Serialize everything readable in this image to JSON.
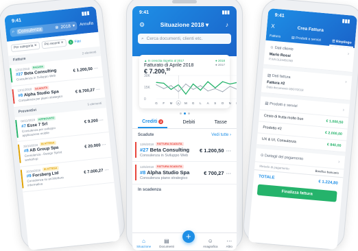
{
  "status_time": "9:41",
  "phone1": {
    "search_value": "Consulenza",
    "year": "2018",
    "cancel_label": "Annulla",
    "chips": [
      "Per categoria",
      "Più recenti"
    ],
    "filters_label": "Filtri",
    "filters_count": "1",
    "sections": [
      {
        "title": "Fatture",
        "count": "2 elementi",
        "rows": [
          {
            "date": "12/11/2018",
            "badge": "PAGATA",
            "badge_color": "#25b36b",
            "badge_bg": "#dff5e9",
            "number": "#27",
            "name": "Beta Consulting",
            "desc": "Consulenza in Sviluppo Web",
            "amount": "€ 1.200,50"
          },
          {
            "date": "12/11/2018",
            "badge": "SCADUTA",
            "badge_color": "#e8453c",
            "badge_bg": "#fde3e1",
            "number": "#8",
            "name": "Alpha Studio Spa",
            "desc": "Consulenza per piano strategico",
            "amount": "€ 8.700,27"
          }
        ]
      },
      {
        "title": "Preventivi",
        "count": "5 elementi",
        "rows": [
          {
            "date": "02/11/2018",
            "badge": "APPROVATO",
            "badge_color": "#25b36b",
            "badge_bg": "#dff5e9",
            "number": "#7",
            "name": "Esse 7 Srl",
            "desc": "Consulenza per sviluppo applicazione mobile",
            "amount": "€ 9.200"
          },
          {
            "date": "28/10/2018",
            "badge": "IN ATTESA",
            "badge_color": "#e0a100",
            "badge_bg": "#fdf1cc",
            "number": "#8",
            "name": "AB Group Spa",
            "desc": "Consulenza - Design Sprint workshop",
            "amount": "€ 20.000"
          },
          {
            "date": "16/10/2018",
            "badge": "IN ATTESA",
            "badge_color": "#e0a100",
            "badge_bg": "#fdf1cc",
            "number": "#9",
            "name": "Forsberg Ltd",
            "desc": "Consulenza su architettura informativa",
            "amount": "€ 7.000,27"
          }
        ]
      }
    ]
  },
  "phone2": {
    "title": "Situazione 2018",
    "search_placeholder": "Cerca documenti, clienti etc.",
    "chart_trend": "In crescita rispetto al 2017",
    "chart_label": "Fatturato di Aprile 2018",
    "chart_total": "€ 7.200,",
    "chart_total_cents": "50",
    "chart_data": {
      "type": "line",
      "categories": [
        "G",
        "F",
        "M",
        "A",
        "M",
        "G",
        "L",
        "A",
        "S",
        "O",
        "N",
        "D"
      ],
      "y_ticks": [
        "30K",
        "15K",
        "0"
      ],
      "ylim": [
        0,
        30000
      ],
      "series": [
        {
          "name": "2018",
          "color": "#25b36b",
          "values": [
            21000,
            20000,
            12000,
            18000,
            6000,
            19000,
            11000,
            22000,
            14000,
            22000,
            19000,
            21000
          ]
        },
        {
          "name": "2017",
          "color": "#9aa4b1",
          "values": [
            18000,
            13000,
            17000,
            9000,
            19000,
            12000,
            17000,
            10000,
            13000,
            9000,
            16000,
            12000
          ]
        }
      ]
    },
    "tabs": [
      {
        "label": "Crediti",
        "badge": "2"
      },
      {
        "label": "Debiti",
        "badge": ""
      },
      {
        "label": "Tasse",
        "badge": ""
      }
    ],
    "scadute_label": "Scadute",
    "view_all_label": "Vedi tutte",
    "rows": [
      {
        "date": "12/6/2018",
        "badge": "FATTURA SCADUTA",
        "number": "#27",
        "name": "Beta Consulting",
        "desc": "Consulenza in Sviluppo Web",
        "amount": "€ 1.200,50"
      },
      {
        "date": "12/6/2018",
        "badge": "FATTURA SCADUTA",
        "number": "#8",
        "name": "Alpha Studio Spa",
        "desc": "Consulenza piano strategico",
        "amount": "€ 700,27"
      }
    ],
    "in_scadenza_label": "In scadenza",
    "nav": [
      "Situazione",
      "Documenti",
      "Anagrafica",
      "Altro"
    ]
  },
  "phone3": {
    "close_label": "X",
    "title": "Crea Fattura",
    "tabs": [
      "Fattura",
      "Prodotti e servizi",
      "Riepilogo"
    ],
    "client_header": "Dati cliente",
    "client_name": "Mario Rossi",
    "client_vat": "P.IVA 0123456789",
    "invoice_header": "Dati fattura",
    "invoice_name": "Fattura #2",
    "invoice_date": "Data documento 08/07/2018",
    "products_header": "Prodotti e servizi",
    "products": [
      {
        "name": "Cesto di frutta molto buo",
        "price": "€ 1.000,50"
      },
      {
        "name": "Prodotto #2",
        "price": "€ 2.000,00"
      },
      {
        "name": "UX & UI, Consulenza",
        "price": "€ 840,00"
      }
    ],
    "payment_header": "Dettagli del pagamento",
    "payment_method_label": "Metodo di pagamento",
    "payment_method": "Bonifico bancario",
    "total_label": "TOTALE",
    "total_value": "€ 1.224,80",
    "cta_label": "Finalizza fattura"
  }
}
